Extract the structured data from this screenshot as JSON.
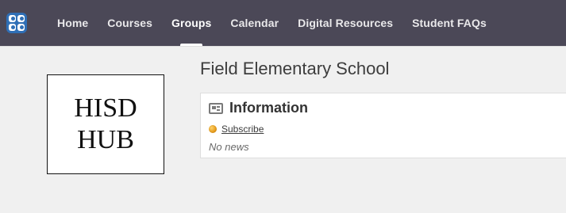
{
  "top_nav": {
    "items": [
      {
        "label": "Home"
      },
      {
        "label": "Courses"
      },
      {
        "label": "Groups",
        "active": true
      },
      {
        "label": "Calendar"
      },
      {
        "label": "Digital Resources"
      },
      {
        "label": "Student FAQs"
      }
    ]
  },
  "page": {
    "title": "Field Elementary School"
  },
  "overlay_box": {
    "line1": "HISD",
    "line2": "HUB"
  },
  "info_card": {
    "title": "Information",
    "subscribe_label": "Subscribe",
    "empty_text": "No news"
  },
  "icons": {
    "app_logo": "app-logo-icon",
    "news": "news-icon",
    "rss": "rss-icon"
  },
  "colors": {
    "nav_bg": "#4b4857",
    "nav_text": "#ffffff",
    "page_bg": "#f0f0f0",
    "card_bg": "#ffffff",
    "rss_orange": "#e59a1a"
  }
}
